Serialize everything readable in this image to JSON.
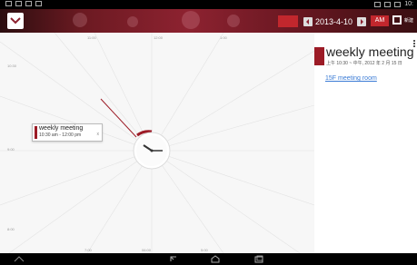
{
  "status_bar": {
    "time": "10:"
  },
  "toolbar": {
    "today_label": "",
    "date": "2013-4-10",
    "ampm": "AM",
    "new_label": "新建"
  },
  "clock": {
    "hour_labels": {
      "top_left": "11:00",
      "top_center": "12:00",
      "top_right": "1:00",
      "left_upper": "10:30",
      "left_lower": "9:00",
      "left_bottom": "8:00",
      "bottom_left": "7:00",
      "bottom_center": "06:00",
      "bottom_right": "5:00"
    }
  },
  "event_card": {
    "title": "weekly meeting",
    "time": "10:30 am - 12:00 pm",
    "close": "x"
  },
  "detail": {
    "title": "weekly meeting",
    "subtitle": "上午 10:30 ~ 中午, 2012 年 2 月 15 日",
    "location": "15F meeting room"
  },
  "colors": {
    "accent": "#9c1b26",
    "link": "#3a7bd5",
    "button_red": "#c1272d"
  }
}
